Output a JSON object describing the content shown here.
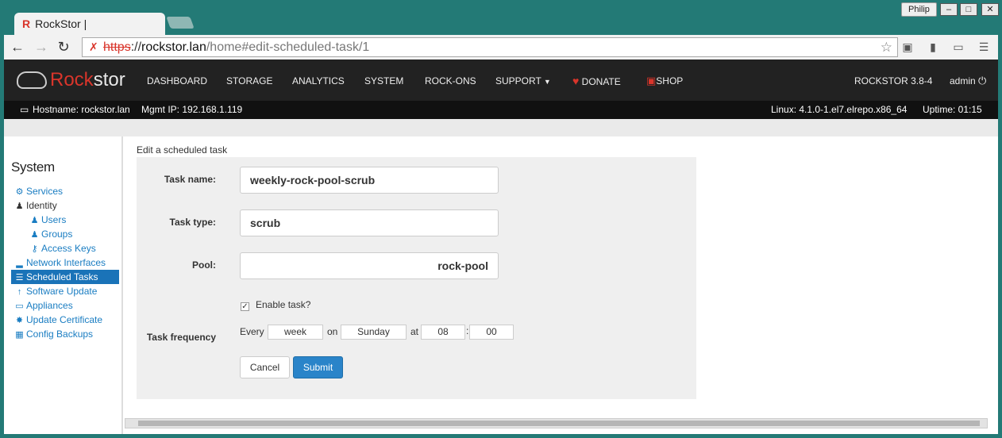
{
  "browser": {
    "tab_title": "RockStor |",
    "tab_favicon": "R",
    "profile_name": "Philip",
    "url_scheme": "https",
    "url_sep": "://",
    "url_host": "rockstor.lan",
    "url_path": "/home#edit-scheduled-task/1"
  },
  "nav": {
    "logo_prefix": "Rock",
    "logo_suffix": "stor",
    "items": [
      "DASHBOARD",
      "STORAGE",
      "ANALYTICS",
      "SYSTEM",
      "ROCK-ONS",
      "SUPPORT"
    ],
    "donate": "DONATE",
    "shop": "SHOP",
    "version": "ROCKSTOR 3.8-4",
    "user": "admin"
  },
  "infobar": {
    "hostname": "Hostname: rockstor.lan",
    "mgmt_ip": "Mgmt IP: 192.168.1.119",
    "linux": "Linux: 4.1.0-1.el7.elrepo.x86_64",
    "uptime": "Uptime: 01:15"
  },
  "sidebar": {
    "title": "System",
    "items": [
      {
        "label": "Services"
      },
      {
        "label": "Identity"
      },
      {
        "label": "Users"
      },
      {
        "label": "Groups"
      },
      {
        "label": "Access Keys"
      },
      {
        "label": "Network Interfaces"
      },
      {
        "label": "Scheduled Tasks"
      },
      {
        "label": "Software Update"
      },
      {
        "label": "Appliances"
      },
      {
        "label": "Update Certificate"
      },
      {
        "label": "Config Backups"
      }
    ]
  },
  "form": {
    "breadcrumb": "Edit a scheduled task",
    "task_name_label": "Task name:",
    "task_name_value": "weekly-rock-pool-scrub",
    "task_type_label": "Task type:",
    "task_type_value": "scrub",
    "pool_label": "Pool:",
    "pool_value": "rock-pool",
    "enable_label": "Enable task?",
    "enable_checked": true,
    "frequency_label": "Task frequency",
    "every_label": "Every",
    "every_value": "week",
    "on_label": "on",
    "on_value": "Sunday",
    "at_label": "at",
    "hour_value": "08",
    "colon": ":",
    "minute_value": "00",
    "cancel_label": "Cancel",
    "submit_label": "Submit"
  },
  "colors": {
    "brand_red": "#d9352b",
    "link_blue": "#1a7dc2",
    "active_blue": "#1a73b8",
    "navbar": "#222222"
  }
}
